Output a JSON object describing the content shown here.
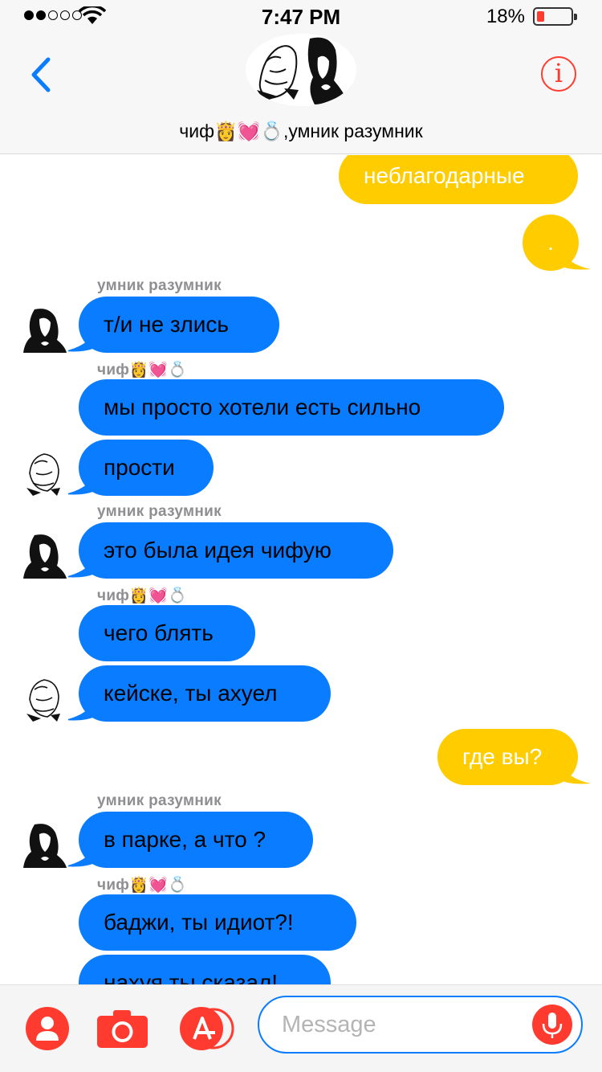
{
  "status_bar": {
    "time": "7:47 PM",
    "battery_percent": "18%",
    "signal_icon": "signal-dots-icon",
    "wifi_icon": "wifi-icon",
    "battery_icon": "battery-low-icon"
  },
  "header": {
    "title": "чиф👸💓💍,умник разумник",
    "back_icon": "chevron-left-icon",
    "info_icon": "info-icon",
    "info_glyph": "i",
    "accent_color": "#ff3b30",
    "back_color": "#0a7cff"
  },
  "messages": [
    {
      "side": "out",
      "text": "неблагодарные"
    },
    {
      "side": "out",
      "text": "."
    },
    {
      "side": "in",
      "sender": "умник разумник",
      "text": "т/и не злись"
    },
    {
      "side": "in",
      "sender": "чиф👸💓💍",
      "text": "мы просто хотели есть сильно"
    },
    {
      "side": "in",
      "text": "прости"
    },
    {
      "side": "in",
      "sender": "умник разумник",
      "text": "это была идея чифую"
    },
    {
      "side": "in",
      "sender": "чиф👸💓💍",
      "text": "чего блять"
    },
    {
      "side": "in",
      "text": "кейске, ты ахуел"
    },
    {
      "side": "out",
      "text": "где вы?"
    },
    {
      "side": "in",
      "sender": "умник разумник",
      "text": "в парке, а что ?"
    },
    {
      "side": "in",
      "sender": "чиф👸💓💍",
      "text": "баджи, ты идиот?!"
    },
    {
      "side": "in",
      "text": "нахуя ты сказал!"
    }
  ],
  "colors": {
    "outgoing_bubble": "#ffcc00",
    "incoming_bubble": "#0a7cff",
    "sender_label": "#8e8e93"
  },
  "bottom_bar": {
    "contact_icon": "person-icon",
    "camera_icon": "camera-icon",
    "apps_icon": "app-store-icon",
    "mic_icon": "microphone-icon",
    "input_placeholder": "Message",
    "input_value": ""
  }
}
